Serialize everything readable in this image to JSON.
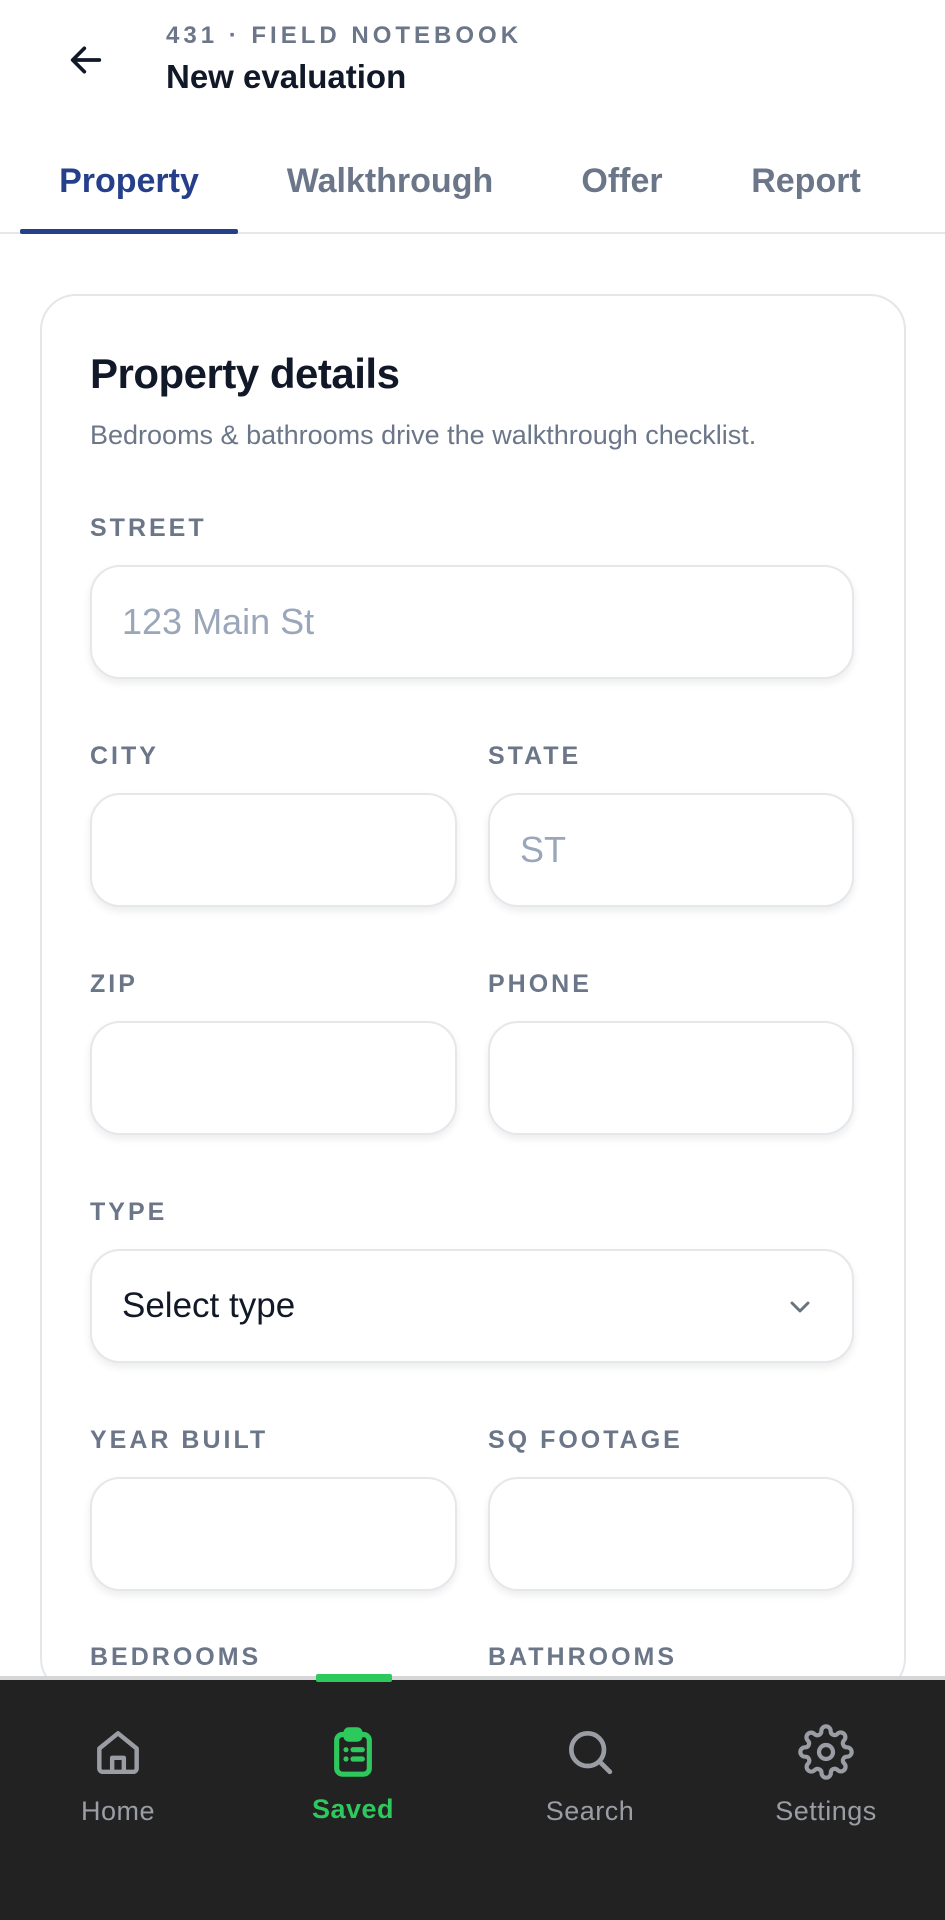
{
  "header": {
    "eyebrow": "431 · FIELD NOTEBOOK",
    "title": "New evaluation",
    "back_icon": "arrow-left-icon"
  },
  "tabs": [
    {
      "label": "Property",
      "active": true
    },
    {
      "label": "Walkthrough",
      "active": false
    },
    {
      "label": "Offer",
      "active": false
    },
    {
      "label": "Report",
      "active": false
    }
  ],
  "form": {
    "title": "Property details",
    "subtitle": "Bedrooms & bathrooms drive the walkthrough checklist.",
    "street": {
      "label": "STREET",
      "value": "",
      "placeholder": "123 Main St"
    },
    "city": {
      "label": "CITY",
      "value": "",
      "placeholder": ""
    },
    "state": {
      "label": "STATE",
      "value": "",
      "placeholder": "ST"
    },
    "zip": {
      "label": "ZIP",
      "value": "",
      "placeholder": ""
    },
    "phone": {
      "label": "PHONE",
      "value": "",
      "placeholder": ""
    },
    "type": {
      "label": "TYPE",
      "value": "Select type"
    },
    "year_built": {
      "label": "YEAR BUILT",
      "value": "",
      "placeholder": ""
    },
    "sq_footage": {
      "label": "SQ FOOTAGE",
      "value": "",
      "placeholder": ""
    },
    "bedrooms": {
      "label": "BEDROOMS"
    },
    "bathrooms": {
      "label": "BATHROOMS"
    }
  },
  "bottom_nav": {
    "items": [
      {
        "label": "Home",
        "icon": "home-icon",
        "active": false
      },
      {
        "label": "Saved",
        "icon": "clipboard-list-icon",
        "active": true
      },
      {
        "label": "Search",
        "icon": "search-icon",
        "active": false
      },
      {
        "label": "Settings",
        "icon": "gear-icon",
        "active": false
      }
    ]
  },
  "colors": {
    "accent": "#263f8a",
    "active_nav": "#2ec95c",
    "muted": "#6b7689",
    "nav_bg": "#222223"
  }
}
